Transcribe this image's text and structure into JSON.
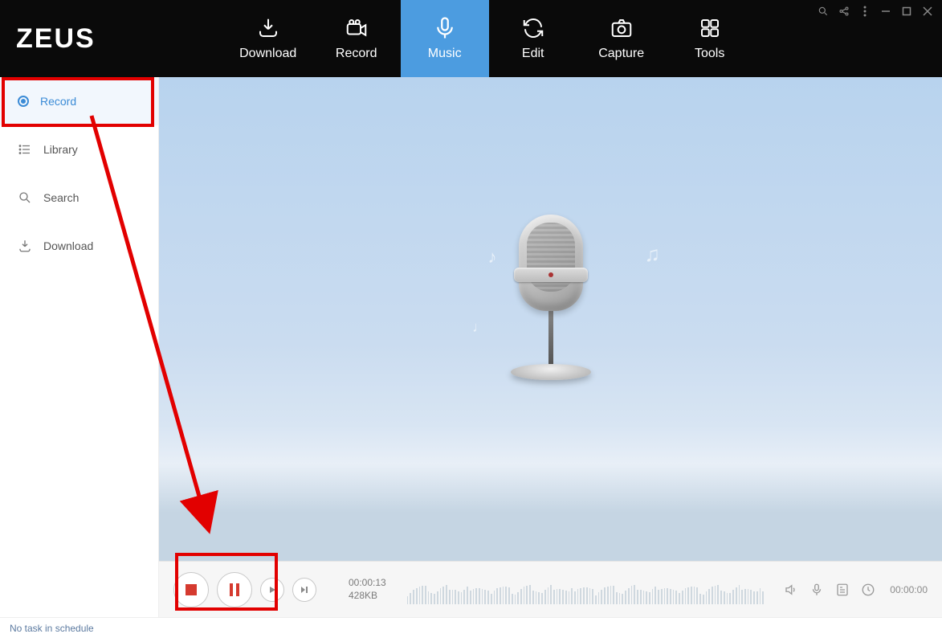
{
  "app": {
    "logo": "ZEUS"
  },
  "topnav": {
    "items": [
      {
        "label": "Download"
      },
      {
        "label": "Record"
      },
      {
        "label": "Music"
      },
      {
        "label": "Edit"
      },
      {
        "label": "Capture"
      },
      {
        "label": "Tools"
      }
    ],
    "active_index": 2
  },
  "sidebar": {
    "items": [
      {
        "label": "Record"
      },
      {
        "label": "Library"
      },
      {
        "label": "Search"
      },
      {
        "label": "Download"
      }
    ],
    "active_index": 0
  },
  "recording": {
    "elapsed": "00:00:13",
    "size": "428KB",
    "total_time": "00:00:00"
  },
  "status_bar": {
    "text": "No task in schedule"
  },
  "colors": {
    "accent": "#4c9ce0",
    "annotation": "#e20000",
    "record_red": "#d53a2f"
  }
}
